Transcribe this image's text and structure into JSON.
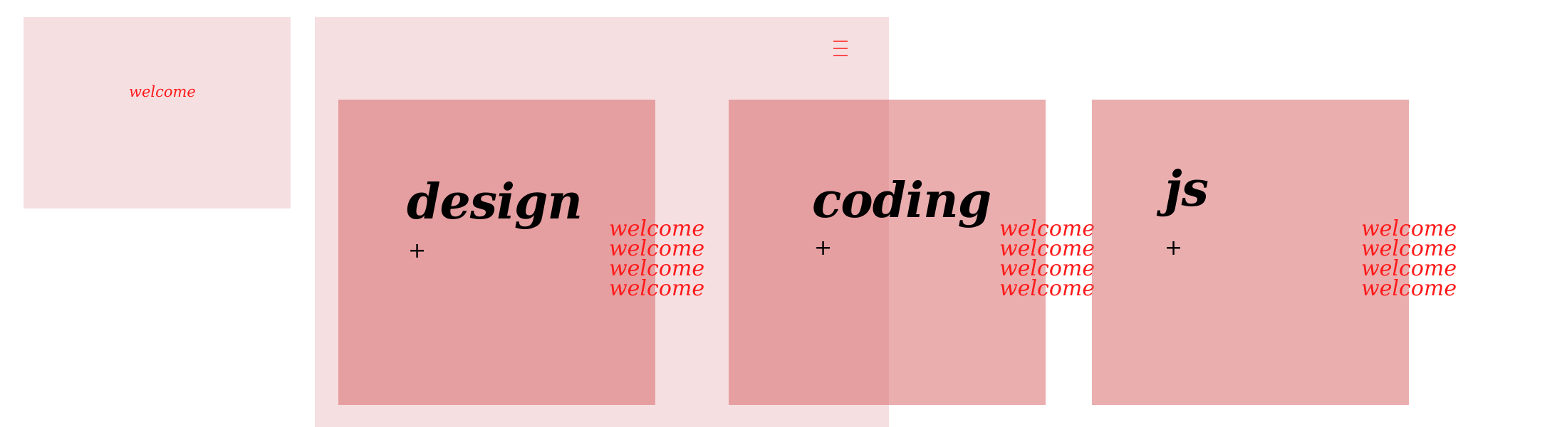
{
  "header": {
    "welcome_text": "welcome",
    "menu_icon": "hamburger-menu-icon"
  },
  "cards": [
    {
      "title": "design",
      "plus": "+",
      "welcome": [
        "welcome",
        "welcome",
        "welcome",
        "welcome"
      ]
    },
    {
      "title": "coding",
      "plus": "+",
      "welcome": [
        "welcome",
        "welcome",
        "welcome",
        "welcome"
      ]
    },
    {
      "title": "js",
      "plus": "+",
      "welcome": [
        "welcome",
        "welcome",
        "welcome",
        "welcome"
      ]
    }
  ],
  "colors": {
    "panel": "#f6dfe0",
    "card": "#e7a3a4",
    "accent": "#ff1a1a",
    "text": "#000000"
  }
}
